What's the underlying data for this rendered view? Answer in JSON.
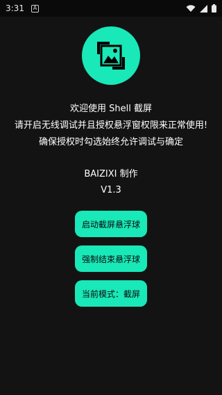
{
  "status_bar": {
    "time": "3:31",
    "notification_icon": "a-notification-icon",
    "wifi_icon": "wifi-icon",
    "signal_icon": "signal-icon",
    "battery_icon": "battery-icon"
  },
  "app": {
    "logo_icon": "screenshot-image-icon",
    "accent_color": "#19e8b8",
    "intro_lines": [
      "欢迎使用 Shell 截屏",
      "请开启无线调试并且授权悬浮窗权限来正常使用!",
      "确保授权时勾选始终允许调试与确定"
    ],
    "author": "BAIZIXI 制作",
    "version": "V1.3",
    "buttons": {
      "start_float": "启动截屏悬浮球",
      "stop_float": "强制结束悬浮球",
      "current_mode": "当前模式：截屏"
    }
  }
}
